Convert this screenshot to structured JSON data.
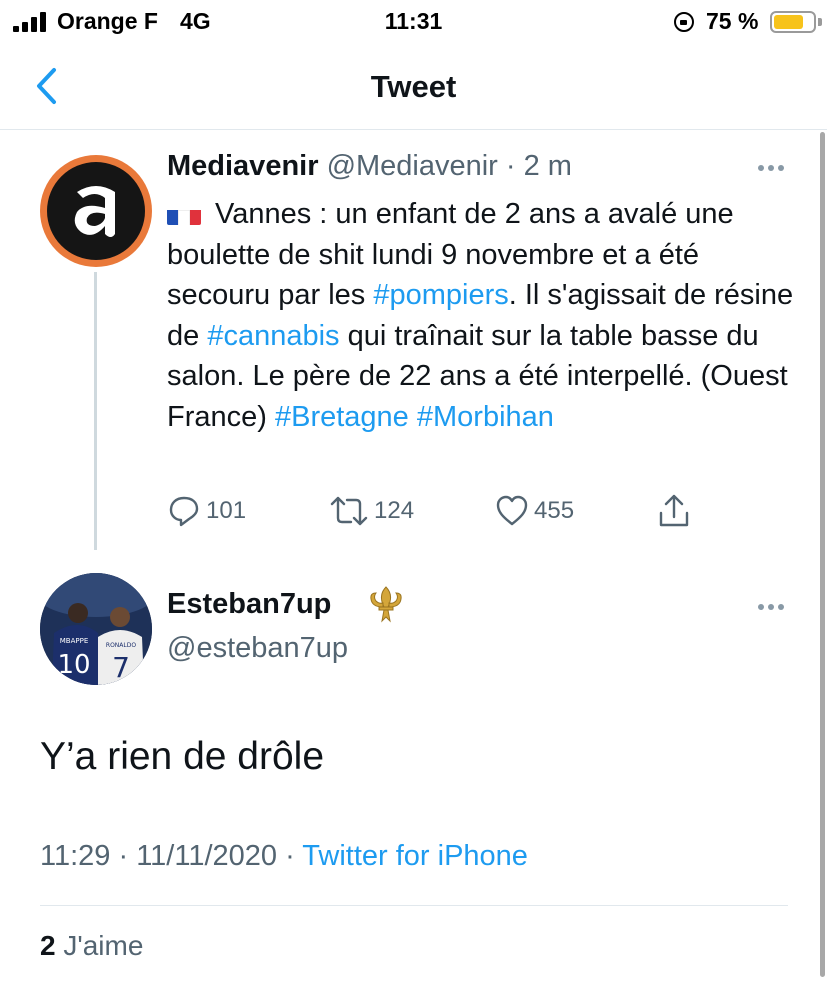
{
  "status_bar": {
    "carrier": "Orange F",
    "network": "4G",
    "time": "11:31",
    "battery_percent": "75 %",
    "battery_level": 0.75,
    "battery_color": "#f7c31b"
  },
  "nav": {
    "title": "Tweet",
    "back_icon": "chevron-left-icon"
  },
  "parent_tweet": {
    "name": "Mediavenir",
    "handle": "@Mediavenir",
    "time": "· 2 m",
    "text_part1": "Vannes : un enfant de 2 ans a avalé une boulette de shit lundi 9 novembre et a été secouru par les ",
    "hashtag1": "#pompiers",
    "text_part2": ". Il s'agissait de résine de ",
    "hashtag2": "#cannabis",
    "text_part3": " qui traînait sur la table basse du salon. Le père de 22 ans a été interpellé. (Ouest France) ",
    "hashtag3": "#Bretagne",
    "hashtag4": "#Morbihan",
    "replies": "101",
    "retweets": "124",
    "likes": "455"
  },
  "reply_tweet": {
    "name": "Esteban7up",
    "handle": "@esteban7up",
    "text": "Y’a rien de drôle",
    "timestamp": "11:29 · 11/11/2020 · ",
    "source": "Twitter for iPhone",
    "like_count": "2",
    "like_label": "J'aime",
    "jersey_left_name": "MBAPPE",
    "jersey_left_number": "10",
    "jersey_right_name": "RONALDO",
    "jersey_right_number": "7"
  },
  "colors": {
    "link": "#1d9bf0",
    "secondary_text": "#536471",
    "avatar_ring": "#e9793a"
  }
}
